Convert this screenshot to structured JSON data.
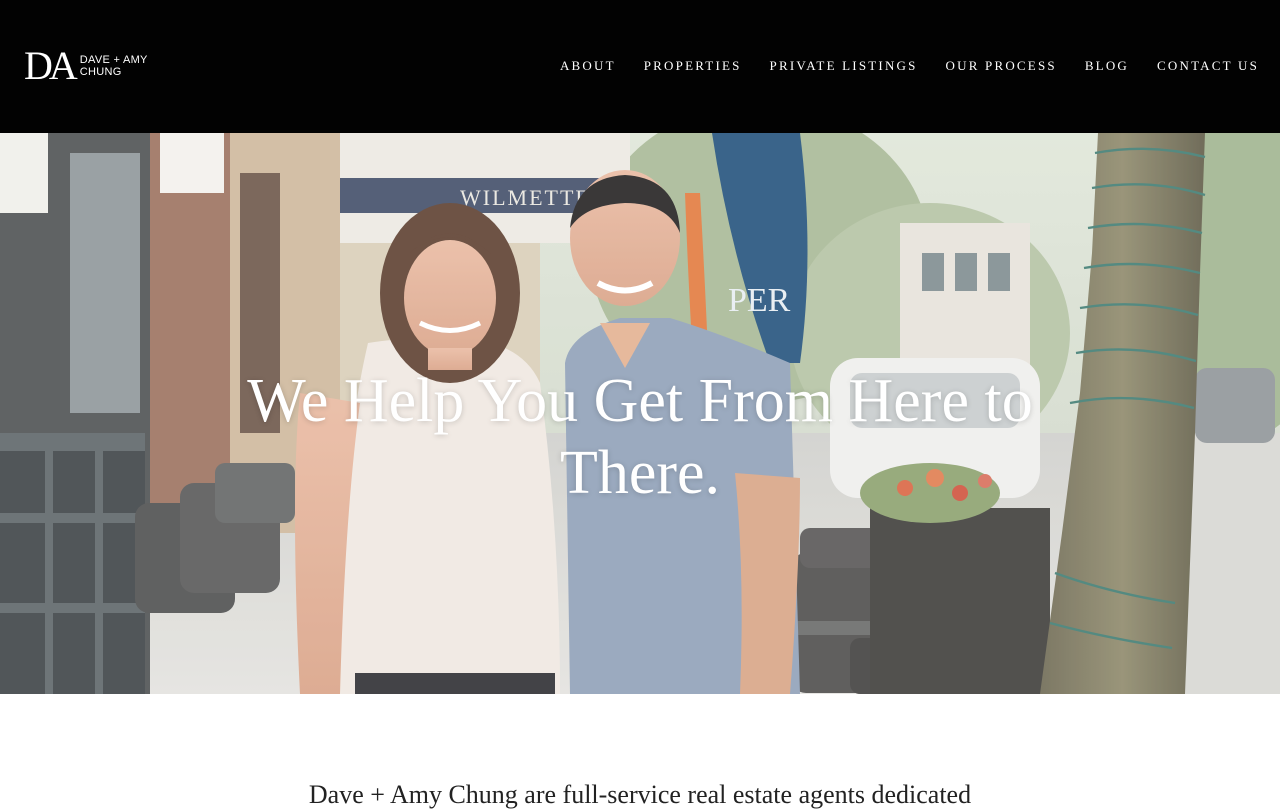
{
  "brand": {
    "monogram": "DA",
    "name_line1": "DAVE + AMY",
    "name_line2": "CHUNG"
  },
  "nav": {
    "items": [
      {
        "label": "ABOUT"
      },
      {
        "label": "PROPERTIES"
      },
      {
        "label": "PRIVATE LISTINGS"
      },
      {
        "label": "OUR PROCESS"
      },
      {
        "label": "BLOG"
      },
      {
        "label": "CONTACT US"
      }
    ]
  },
  "hero": {
    "title_line1": "We Help You Get From Here to",
    "title_line2": "There.",
    "umbrella_text": "PER",
    "storefront_sign": "WILMETTE"
  },
  "intro": {
    "text": "Dave + Amy Chung are full-service real estate agents dedicated"
  },
  "colors": {
    "header_bg": "#020202",
    "nav_text": "#ffffff",
    "hero_title": "#ffffff"
  }
}
